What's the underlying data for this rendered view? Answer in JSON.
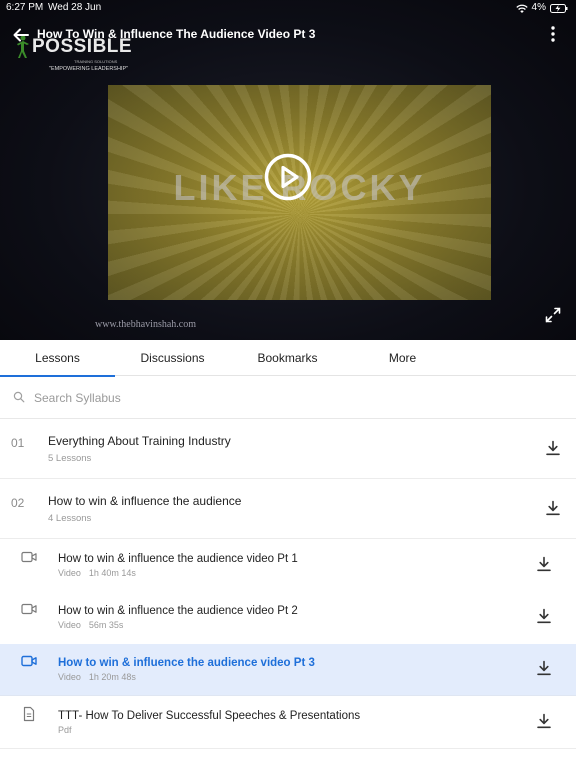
{
  "status_bar": {
    "time": "6:27 PM",
    "date": "Wed 28 Jun",
    "battery": "4%"
  },
  "header": {
    "title": "How To Win & Influence The Audience Video Pt 3"
  },
  "logo": {
    "text": "POSSIBLE",
    "sub1": "TRAINING SOLUTIONS",
    "sub2": "\"EMPOWERING LEADERSHIP\""
  },
  "video": {
    "frame_text": "LIKE ROCKY",
    "watermark": "www.thebhavinshah.com"
  },
  "tabs": [
    {
      "label": "Lessons",
      "active": true
    },
    {
      "label": "Discussions",
      "active": false
    },
    {
      "label": "Bookmarks",
      "active": false
    },
    {
      "label": "More",
      "active": false
    }
  ],
  "search": {
    "placeholder": "Search Syllabus",
    "value": ""
  },
  "sections": [
    {
      "num": "01",
      "title": "Everything About Training Industry",
      "sub": "5 Lessons"
    },
    {
      "num": "02",
      "title": "How to win & influence the audience",
      "sub": "4 Lessons"
    }
  ],
  "lessons": [
    {
      "icon": "video-icon",
      "title": "How to win & influence the audience video Pt 1",
      "type": "Video",
      "duration": "1h 40m 14s",
      "active": false
    },
    {
      "icon": "video-icon",
      "title": "How to win & influence the audience video Pt 2",
      "type": "Video",
      "duration": "56m 35s",
      "active": false
    },
    {
      "icon": "video-icon",
      "title": "How to win & influence the audience video Pt 3",
      "type": "Video",
      "duration": "1h 20m 48s",
      "active": true
    },
    {
      "icon": "document-icon",
      "title": "TTT- How To Deliver Successful Speeches & Presentations",
      "type": "Pdf",
      "duration": "",
      "active": false
    }
  ],
  "colors": {
    "accent": "#1e6fd9",
    "active_row": "#e3ecfc"
  }
}
